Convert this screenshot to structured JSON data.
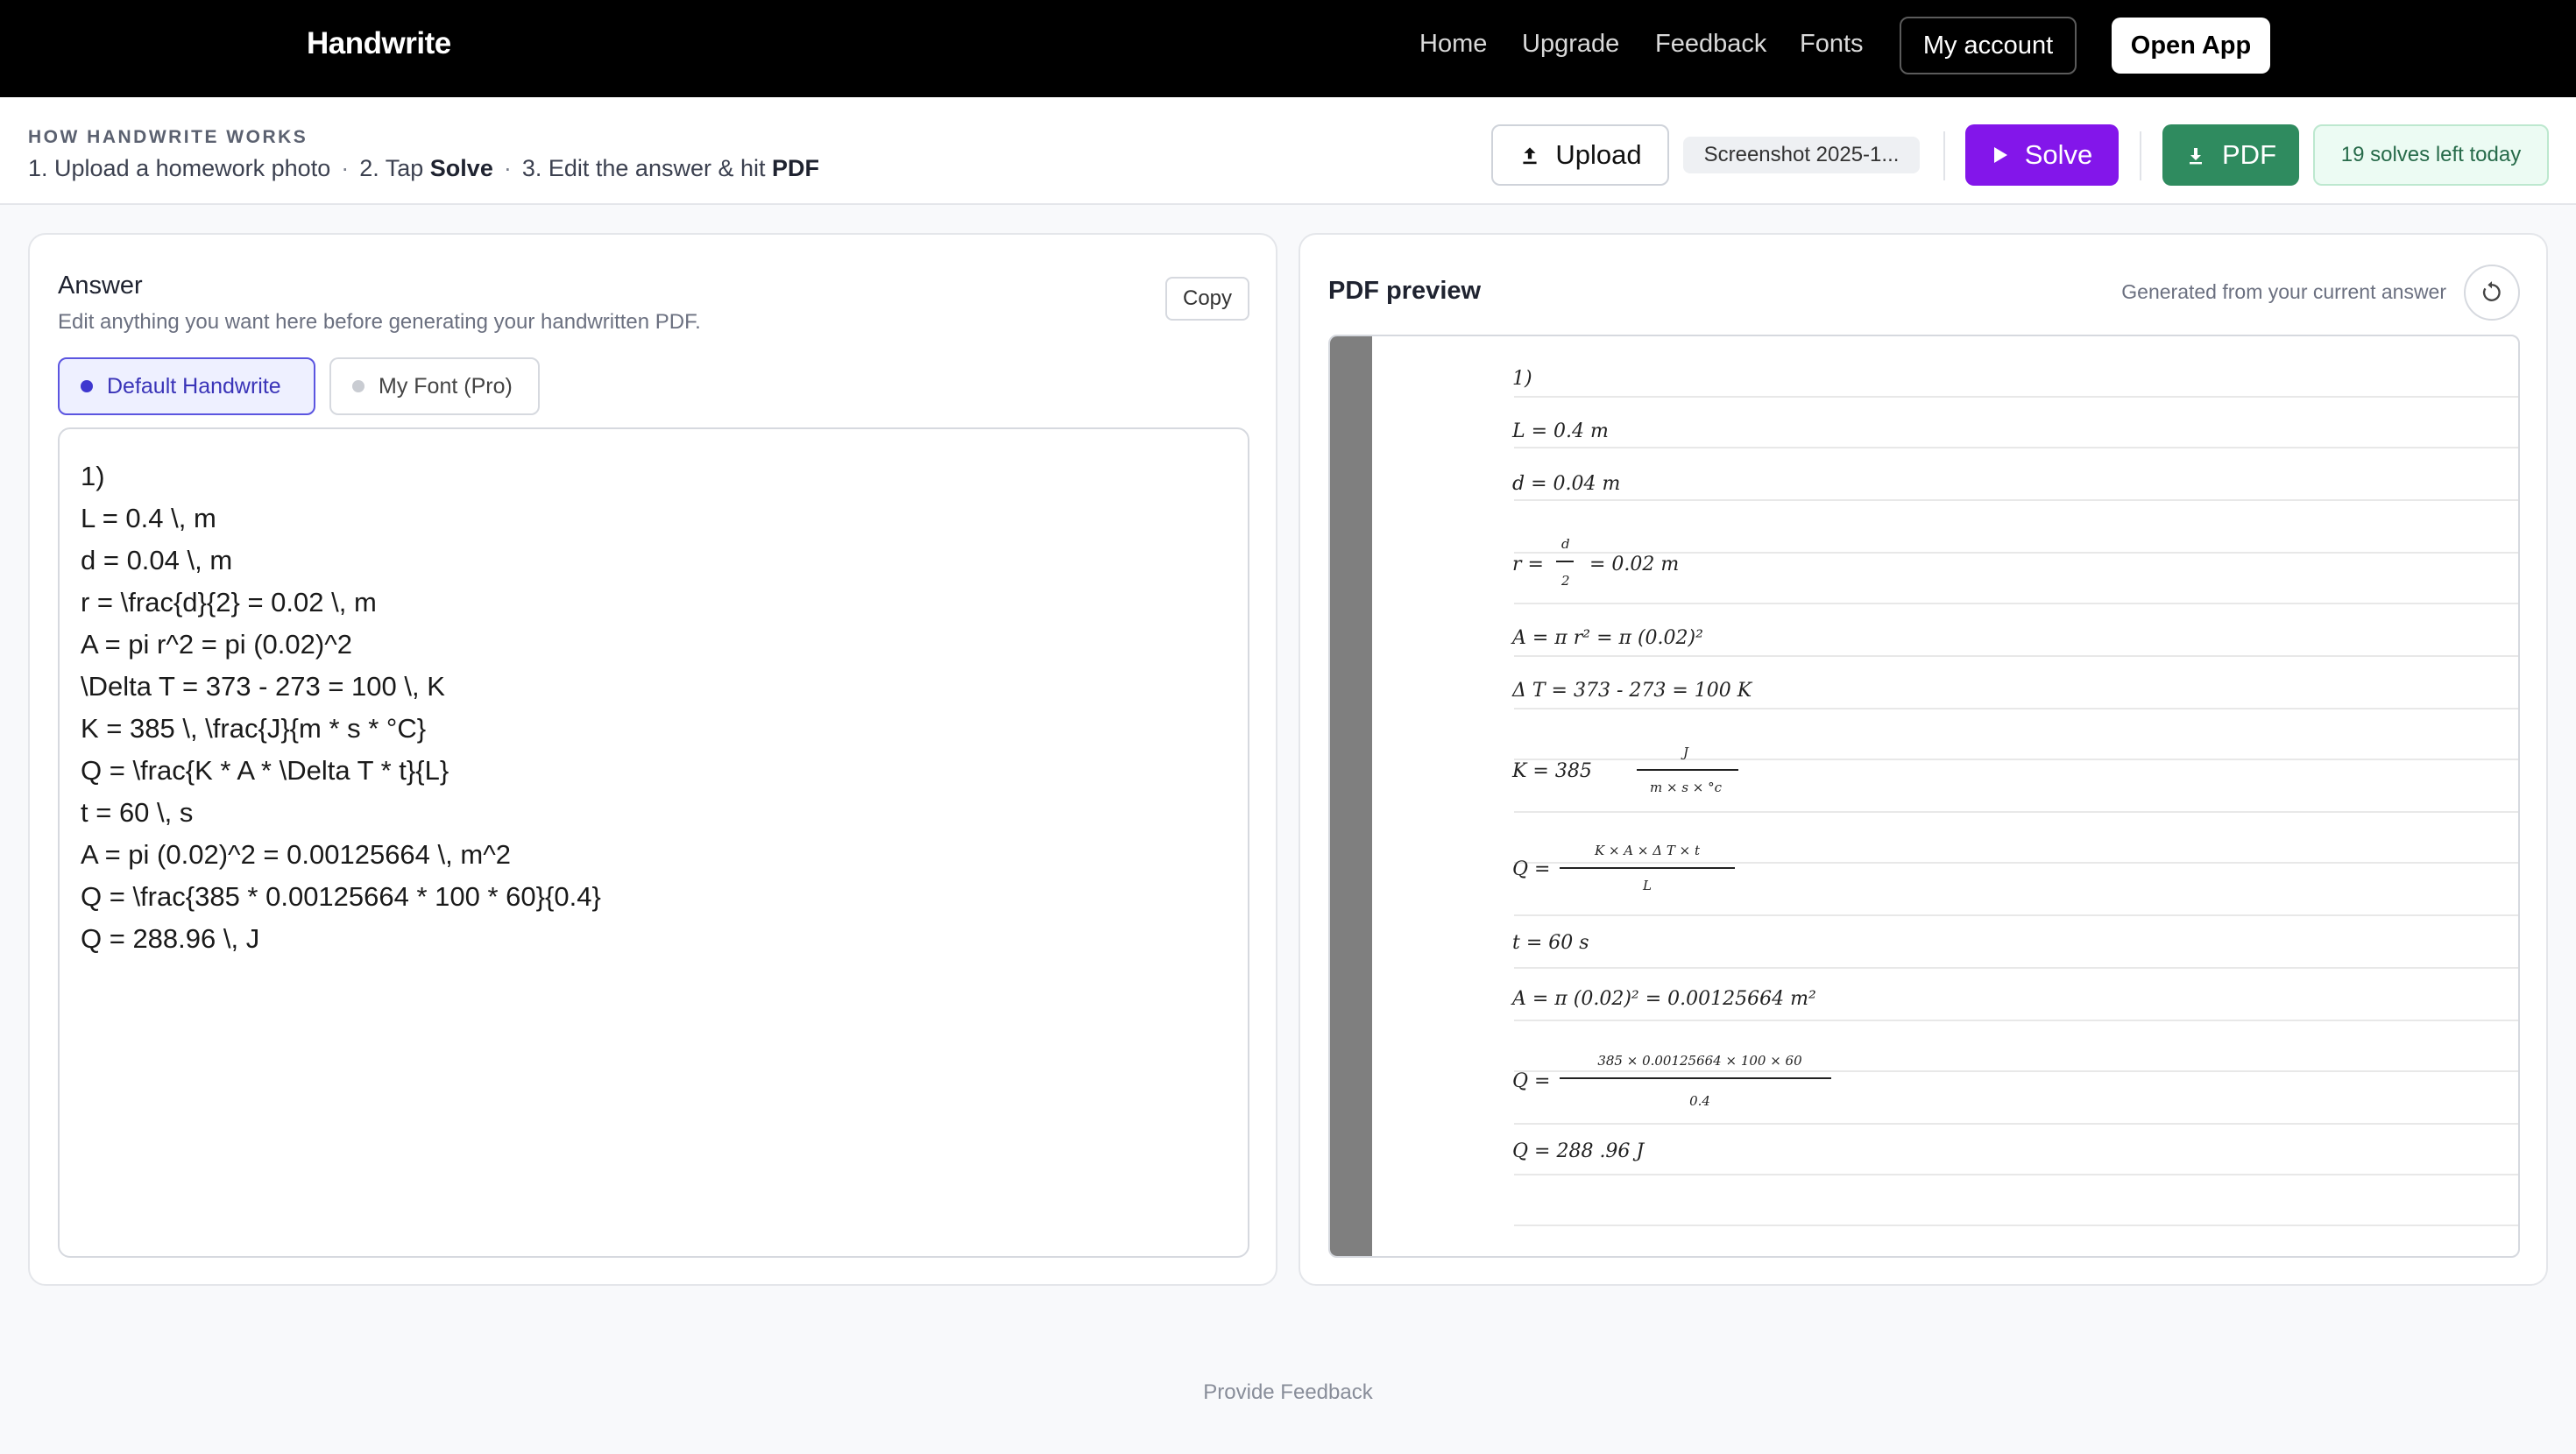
{
  "nav": {
    "brand": "Handwrite",
    "links": [
      "Home",
      "Upgrade",
      "Feedback",
      "Fonts"
    ],
    "account_label": "My account",
    "open_app_label": "Open App"
  },
  "how": {
    "title": "HOW HANDWRITE WORKS",
    "step1": "1. Upload a homework photo",
    "step2_prefix": "2. Tap ",
    "step2_bold": "Solve",
    "step3_prefix": "3. Edit the answer & hit ",
    "step3_bold": "PDF",
    "separator": "·"
  },
  "toolbar": {
    "upload_label": "Upload",
    "file_name": "Screenshot 2025-1...",
    "solve_label": "Solve",
    "pdf_label": "PDF",
    "solves_left": "19 solves left today"
  },
  "answer": {
    "title": "Answer",
    "subtitle": "Edit anything you want here before generating your handwritten PDF.",
    "copy_label": "Copy",
    "font_default": "Default Handwrite",
    "font_custom": "My Font (Pro)",
    "lines": [
      "1)",
      "L = 0.4 \\, m",
      "d = 0.04 \\, m",
      "r = \\frac{d}{2} = 0.02 \\, m",
      "A = pi r^2 = pi (0.02)^2",
      "\\Delta T = 373 - 273 = 100 \\, K",
      "K = 385 \\, \\frac{J}{m * s * °C}",
      "Q = \\frac{K * A * \\Delta T * t}{L}",
      "t = 60 \\, s",
      "A = pi (0.02)^2 = 0.00125664 \\, m^2",
      "Q = \\frac{385 * 0.00125664 * 100 * 60}{0.4}",
      "Q = 288.96 \\, J"
    ]
  },
  "preview": {
    "title": "PDF preview",
    "generated_note": "Generated from your current answer",
    "hw": {
      "l1": "1)",
      "l2": "L = 0.4   m",
      "l3": "d = 0.04   m",
      "r_a": "r =",
      "r_num": "d",
      "r_den": "2",
      "r_b": "= 0.02   m",
      "a1": "A = π  r² = π  (0.02)²",
      "dt": "Δ T = 373  - 273  = 100  K",
      "k_a": "K = 385",
      "k_num": "J",
      "k_den": "m × s × °c",
      "q1_a": "Q =",
      "q1_num": "K × A × Δ T × t",
      "q1_den": "L",
      "t": "t = 60   s",
      "a2": "A = π  (0.02)² = 0.00125664  m²",
      "q2_a": "Q =",
      "q2_num": "385  × 0.00125664 × 100 × 60",
      "q2_den": "0.4",
      "q3": "Q = 288 .96   J"
    }
  },
  "footer": {
    "feedback_link": "Provide Feedback"
  }
}
